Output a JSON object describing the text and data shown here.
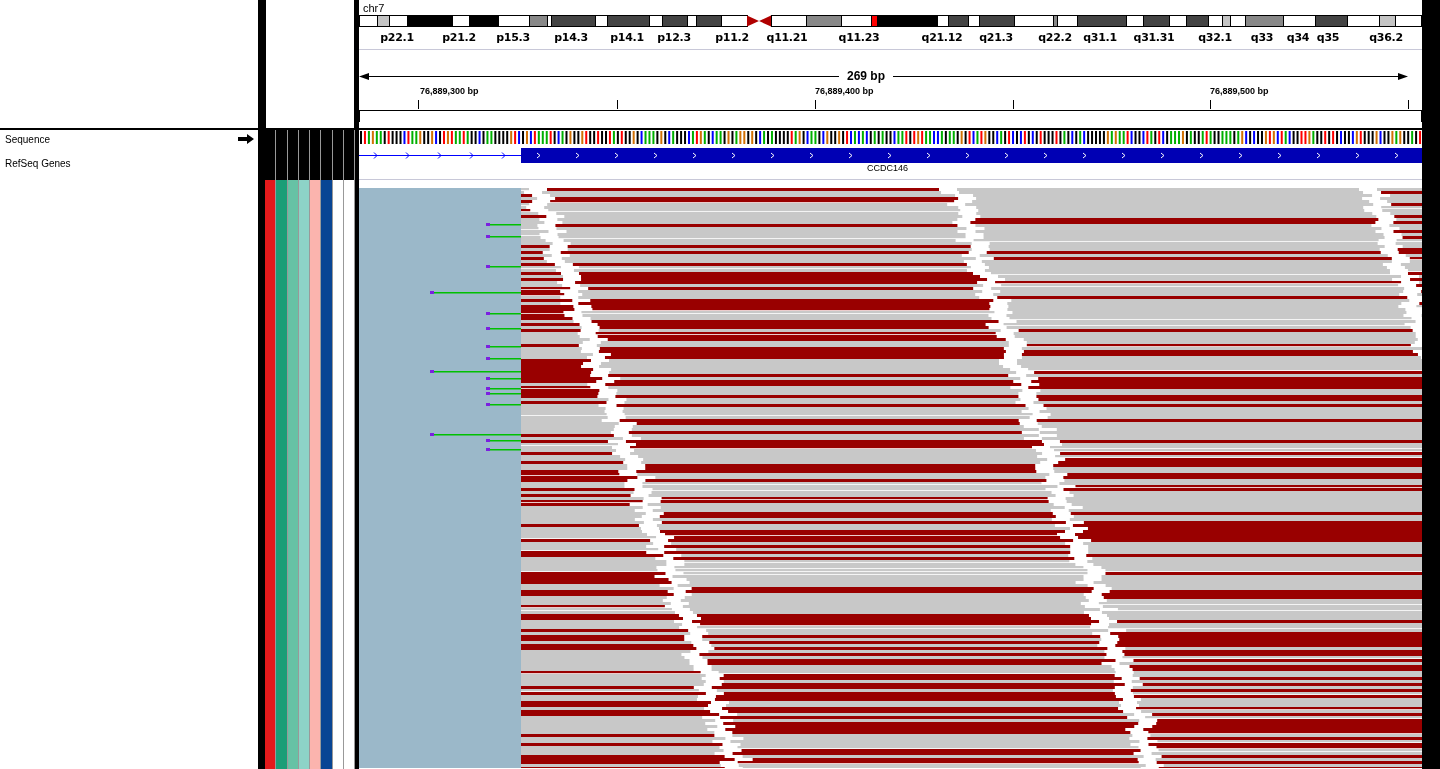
{
  "locus": {
    "chromosome": "chr7",
    "band_labels": [
      "p22.1",
      "p21.2",
      "p15.3",
      "p14.3",
      "p14.1",
      "p12.3",
      "p11.2",
      "q11.21",
      "q11.23",
      "q21.12",
      "q21.3",
      "q22.2",
      "q31.1",
      "q31.31",
      "q32.1",
      "q33",
      "q34",
      "q35",
      "q36.2"
    ]
  },
  "ruler": {
    "span": "269 bp",
    "ticks": [
      "76,889,300 bp",
      "76,889,400 bp",
      "76,889,500 bp"
    ]
  },
  "tracks": [
    {
      "name": "Sequence",
      "kind": "sequence"
    },
    {
      "name": "RefSeq Genes",
      "kind": "gene",
      "feature": "CCDC146"
    }
  ],
  "attributes": [
    {
      "color": "#e41a1c"
    },
    {
      "color": "#1b9e77"
    },
    {
      "color": "#66c2a5"
    },
    {
      "color": "#8dd3c7"
    },
    {
      "color": "#fbb4ae"
    },
    {
      "color": "#084594"
    },
    {
      "color": "#ffffff"
    },
    {
      "color": "#ffffff"
    }
  ]
}
